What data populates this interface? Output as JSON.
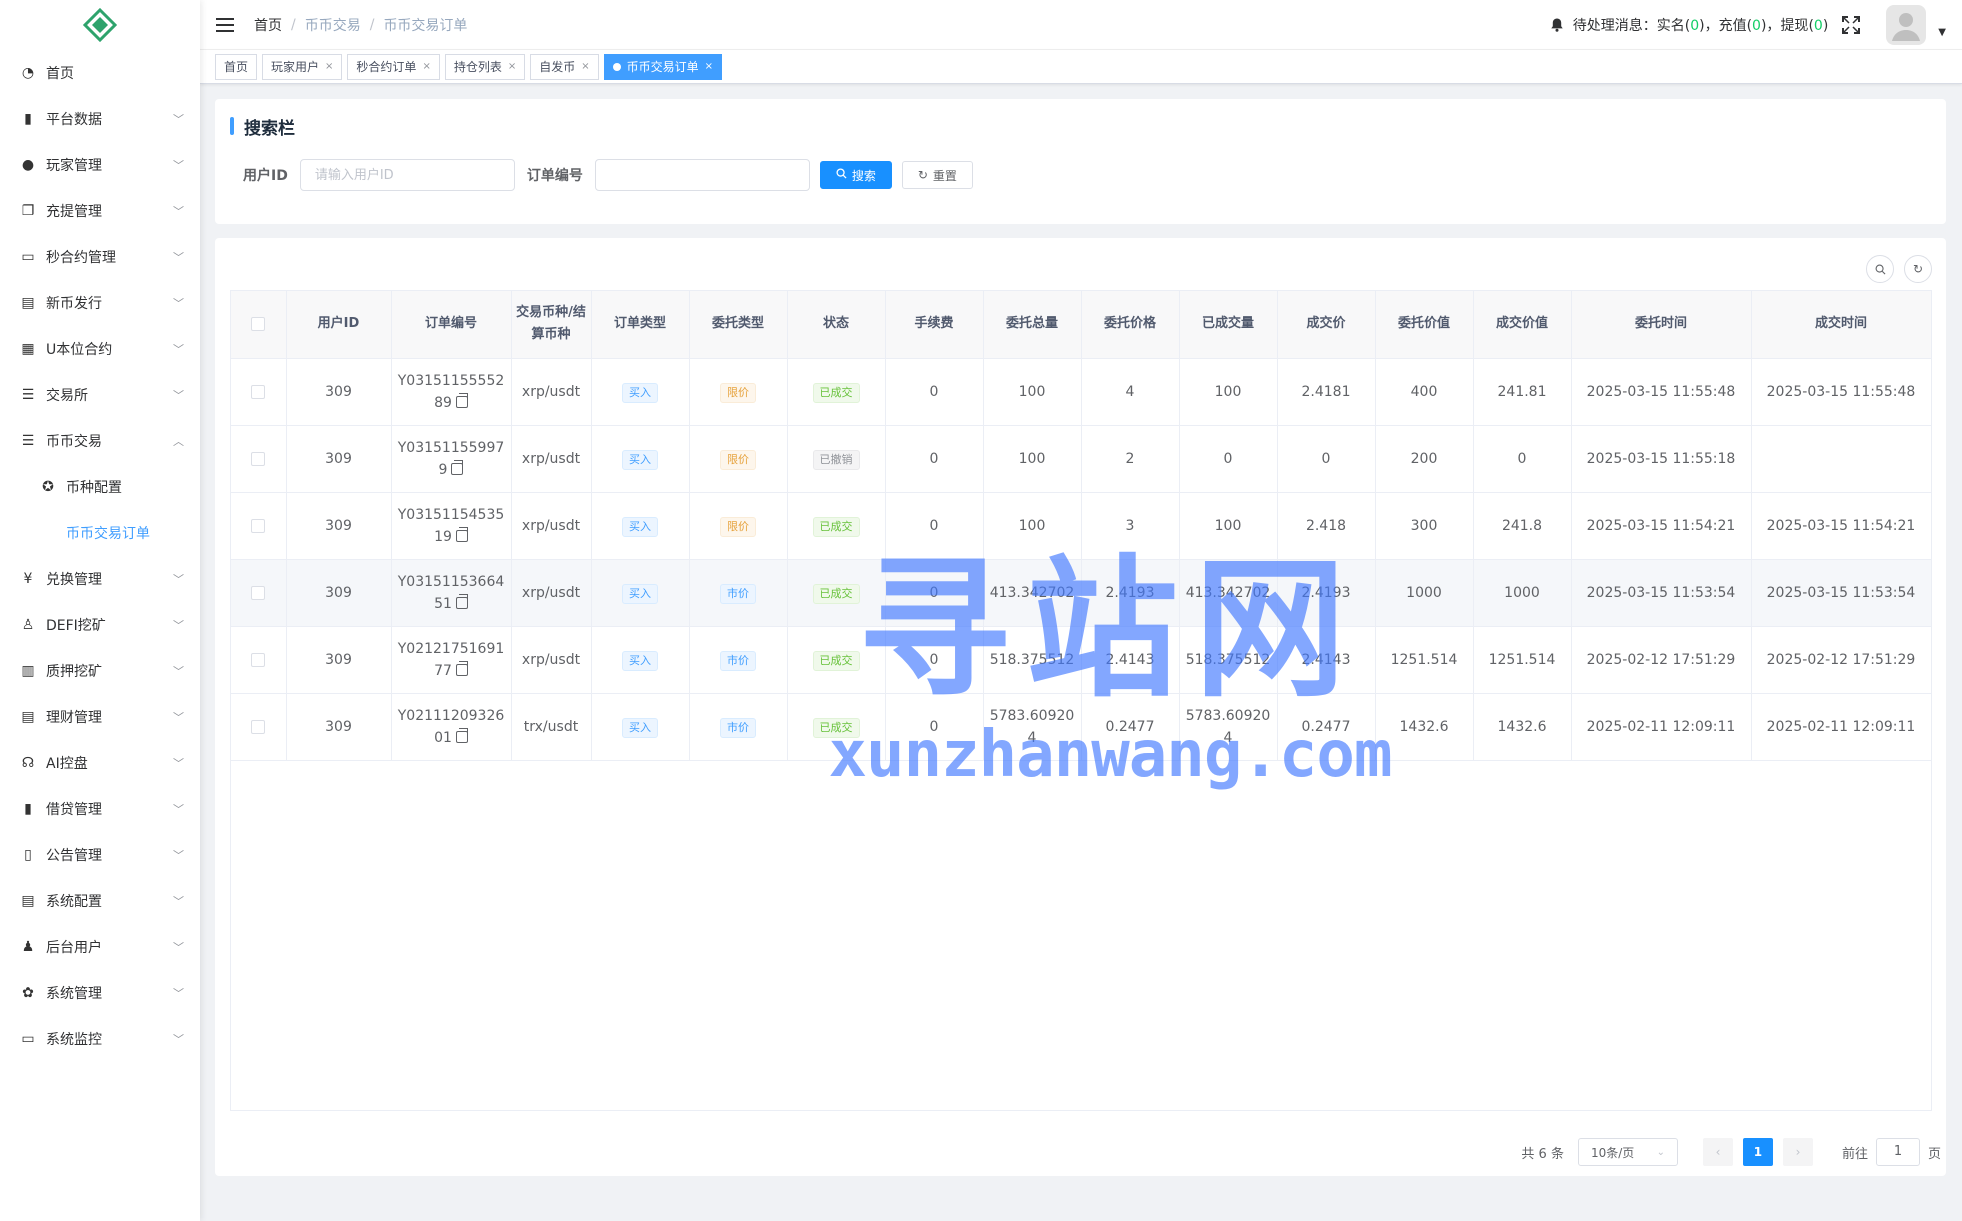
{
  "sidebar": {
    "items": [
      {
        "label": "首页",
        "icon": "dashboard-icon",
        "arrow": false
      },
      {
        "label": "平台数据",
        "icon": "book-icon",
        "arrow": true
      },
      {
        "label": "玩家管理",
        "icon": "user-icon",
        "arrow": true
      },
      {
        "label": "充提管理",
        "icon": "copy-icon",
        "arrow": true
      },
      {
        "label": "秒合约管理",
        "icon": "monitor-icon",
        "arrow": true
      },
      {
        "label": "新币发行",
        "icon": "coin-icon",
        "arrow": true
      },
      {
        "label": "U本位合约",
        "icon": "grid-icon",
        "arrow": true
      },
      {
        "label": "交易所",
        "icon": "list-icon",
        "arrow": true
      },
      {
        "label": "币币交易",
        "icon": "list-icon",
        "arrow": true,
        "expanded": true
      }
    ],
    "sub_items": [
      {
        "label": "币种配置",
        "icon": "settings-icon"
      },
      {
        "label": "币币交易订单",
        "active": true
      }
    ],
    "items_after": [
      {
        "label": "兑换管理",
        "icon": "yen-icon"
      },
      {
        "label": "DEFI挖矿",
        "icon": "person-icon"
      },
      {
        "label": "质押挖矿",
        "icon": "bar-chart-icon"
      },
      {
        "label": "理财管理",
        "icon": "document-icon"
      },
      {
        "label": "AI控盘",
        "icon": "robot-icon"
      },
      {
        "label": "借贷管理",
        "icon": "book-icon"
      },
      {
        "label": "公告管理",
        "icon": "open-book-icon"
      },
      {
        "label": "系统配置",
        "icon": "document-icon"
      },
      {
        "label": "后台用户",
        "icon": "users-icon"
      },
      {
        "label": "系统管理",
        "icon": "gear-icon"
      },
      {
        "label": "系统监控",
        "icon": "monitor-icon"
      }
    ]
  },
  "header": {
    "breadcrumb": [
      "首页",
      "币币交易",
      "币币交易订单"
    ],
    "notice_prefix": "待处理消息：",
    "notice_items": [
      {
        "label": "实名",
        "count": "0"
      },
      {
        "label": "充值",
        "count": "0"
      },
      {
        "label": "提现",
        "count": "0"
      }
    ]
  },
  "tags": [
    {
      "label": "首页",
      "closable": false
    },
    {
      "label": "玩家用户",
      "closable": true
    },
    {
      "label": "秒合约订单",
      "closable": true
    },
    {
      "label": "持仓列表",
      "closable": true
    },
    {
      "label": "自发币",
      "closable": true
    },
    {
      "label": "币币交易订单",
      "closable": true,
      "active": true
    }
  ],
  "search": {
    "title": "搜索栏",
    "user_id_label": "用户ID",
    "user_id_placeholder": "请输入用户ID",
    "order_no_label": "订单编号",
    "order_no_placeholder": "",
    "search_btn": "搜索",
    "reset_btn": "重置"
  },
  "table": {
    "columns": [
      "用户ID",
      "订单编号",
      "交易币种/结算币种",
      "订单类型",
      "委托类型",
      "状态",
      "手续费",
      "委托总量",
      "委托价格",
      "已成交量",
      "成交价",
      "委托价值",
      "成交价值",
      "委托时间",
      "成交时间"
    ],
    "rows": [
      {
        "user_id": "309",
        "order_no": "Y0315115555289",
        "pair": "xrp/usdt",
        "order_type": "买入",
        "entrust_type": "限价",
        "entrust_kind": "limit",
        "status": "已成交",
        "status_kind": "done",
        "fee": "0",
        "total": "100",
        "price": "4",
        "filled": "100",
        "deal_price": "2.4181",
        "entrust_value": "400",
        "deal_value": "241.81",
        "entrust_time": "2025-03-15 11:55:48",
        "deal_time": "2025-03-15 11:55:48"
      },
      {
        "user_id": "309",
        "order_no": "Y031511559979",
        "pair": "xrp/usdt",
        "order_type": "买入",
        "entrust_type": "限价",
        "entrust_kind": "limit",
        "status": "已撤销",
        "status_kind": "cancel",
        "fee": "0",
        "total": "100",
        "price": "2",
        "filled": "0",
        "deal_price": "0",
        "entrust_value": "200",
        "deal_value": "0",
        "entrust_time": "2025-03-15 11:55:18",
        "deal_time": ""
      },
      {
        "user_id": "309",
        "order_no": "Y0315115453519",
        "pair": "xrp/usdt",
        "order_type": "买入",
        "entrust_type": "限价",
        "entrust_kind": "limit",
        "status": "已成交",
        "status_kind": "done",
        "fee": "0",
        "total": "100",
        "price": "3",
        "filled": "100",
        "deal_price": "2.418",
        "entrust_value": "300",
        "deal_value": "241.8",
        "entrust_time": "2025-03-15 11:54:21",
        "deal_time": "2025-03-15 11:54:21"
      },
      {
        "user_id": "309",
        "order_no": "Y0315115366451",
        "pair": "xrp/usdt",
        "order_type": "买入",
        "entrust_type": "市价",
        "entrust_kind": "market",
        "status": "已成交",
        "status_kind": "done",
        "fee": "0",
        "total": "413.342702",
        "price": "2.4193",
        "filled": "413.342702",
        "deal_price": "2.4193",
        "entrust_value": "1000",
        "deal_value": "1000",
        "entrust_time": "2025-03-15 11:53:54",
        "deal_time": "2025-03-15 11:53:54",
        "hover": true
      },
      {
        "user_id": "309",
        "order_no": "Y0212175169177",
        "pair": "xrp/usdt",
        "order_type": "买入",
        "entrust_type": "市价",
        "entrust_kind": "market",
        "status": "已成交",
        "status_kind": "done",
        "fee": "0",
        "total": "518.375512",
        "price": "2.4143",
        "filled": "518.375512",
        "deal_price": "2.4143",
        "entrust_value": "1251.514",
        "deal_value": "1251.514",
        "entrust_time": "2025-02-12 17:51:29",
        "deal_time": "2025-02-12 17:51:29"
      },
      {
        "user_id": "309",
        "order_no": "Y0211120932601",
        "pair": "trx/usdt",
        "order_type": "买入",
        "entrust_type": "市价",
        "entrust_kind": "market",
        "status": "已成交",
        "status_kind": "done",
        "fee": "0",
        "total": "5783.609204",
        "price": "0.2477",
        "filled": "5783.609204",
        "deal_price": "0.2477",
        "entrust_value": "1432.6",
        "deal_value": "1432.6",
        "entrust_time": "2025-02-11 12:09:11",
        "deal_time": "2025-02-11 12:09:11"
      }
    ]
  },
  "pagination": {
    "total_text": "共 6 条",
    "page_size": "10条/页",
    "current_page": "1",
    "goto_prefix": "前往",
    "goto_value": "1",
    "goto_suffix": "页"
  },
  "watermark": {
    "cn": "寻站网",
    "en": "xunzhanwang.com"
  },
  "colors": {
    "primary": "#1890ff",
    "active_menu": "#409eff",
    "notice_count": "#13ce66"
  }
}
